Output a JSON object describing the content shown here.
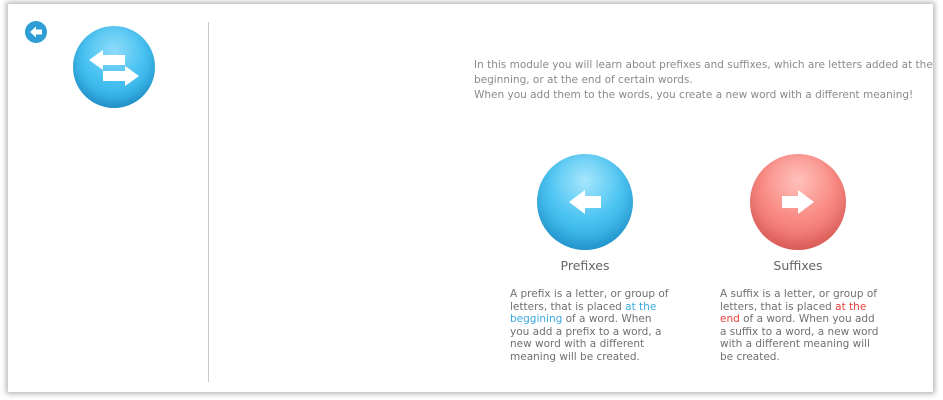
{
  "icons": {
    "back": "circle-arrow-left-icon",
    "logo": "swap-arrows-icon",
    "prefix": "arrow-left-icon",
    "suffix": "arrow-right-icon"
  },
  "colors": {
    "blue": "#45c0f0",
    "red": "#f98a84",
    "highlight_blue": "#3aa8e0",
    "highlight_red": "#e8403a",
    "text": "#8a8a8a"
  },
  "intro": {
    "line1": "In this module you will learn about prefixes and suffixes, which are letters added at the beginning, or at the end of certain words.",
    "line2": "When you add them to the words, you create a new word with a different meaning!"
  },
  "prefix": {
    "title": "Prefixes",
    "desc_before": "A prefix is a letter, or group of letters, that is placed ",
    "desc_highlight": "at the beggining",
    "desc_after": " of a word. When you add a prefix to a word, a new word with a different meaning will be created."
  },
  "suffix": {
    "title": "Suffixes",
    "desc_before": "A suffix is a letter, or group of letters, that is placed ",
    "desc_highlight": "at the end",
    "desc_after": " of a word. When you add a suffix to a word, a new word with a different meaning will be created."
  }
}
